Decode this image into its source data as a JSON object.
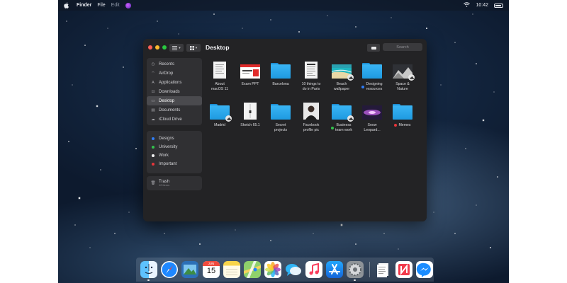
{
  "menubar": {
    "app_name": "Finder",
    "menu_file": "File",
    "menu_edit": "Edit",
    "clock": "10:42"
  },
  "window": {
    "title": "Desktop",
    "search_placeholder": "Search"
  },
  "sidebar": {
    "places": [
      {
        "label": "Recents",
        "icon": "clock-icon"
      },
      {
        "label": "AirDrop",
        "icon": "airdrop-icon"
      },
      {
        "label": "Applications",
        "icon": "applications-icon"
      },
      {
        "label": "Downloads",
        "icon": "download-icon"
      },
      {
        "label": "Desktop",
        "icon": "desktop-icon",
        "selected": true
      },
      {
        "label": "Documents",
        "icon": "document-icon"
      },
      {
        "label": "iCloud Drive",
        "icon": "cloud-icon"
      }
    ],
    "tags": [
      {
        "label": "Designs",
        "color": "#2f7df6"
      },
      {
        "label": "University",
        "color": "#33c24d"
      },
      {
        "label": "Work",
        "color": "#f2f2f2"
      },
      {
        "label": "Important",
        "color": "#e8353a"
      }
    ],
    "trash": {
      "label": "Trash",
      "subtitle": "12 items"
    }
  },
  "files": [
    {
      "label": "About\nmacOS 11",
      "kind": "doc"
    },
    {
      "label": "Exam PPT",
      "kind": "ppt"
    },
    {
      "label": "Barcelona",
      "kind": "folder"
    },
    {
      "label": "10 things to\ndo in Paris",
      "kind": "doc"
    },
    {
      "label": "Beach\nwallpaper",
      "kind": "photo-beach",
      "cloud": true
    },
    {
      "label": "Designing\nresources",
      "kind": "folder",
      "tag_color": "#2f7df6"
    },
    {
      "label": "Space &\nNature",
      "kind": "photo-space",
      "cloud": true
    },
    {
      "label": "Madrid",
      "kind": "folder",
      "cloud": true
    },
    {
      "label": "Sketch 65.1",
      "kind": "sketch"
    },
    {
      "label": "Secret\nprojects",
      "kind": "folder"
    },
    {
      "label": "Facebook\nprofile pic",
      "kind": "photo-person"
    },
    {
      "label": "Business\nteam work",
      "kind": "folder",
      "tag_color": "#33c24d",
      "cloud": true
    },
    {
      "label": "Snow\nLeopard...",
      "kind": "photo-galaxy"
    },
    {
      "label": "Memes",
      "kind": "folder",
      "tag_color": "#e8353a"
    }
  ],
  "dock": {
    "calendar_month": "JUN",
    "calendar_day": "15",
    "apps": [
      "finder-icon",
      "safari-icon",
      "preview-icon",
      "calendar-icon",
      "notes-icon",
      "maps-icon",
      "photos-icon",
      "messages-icon",
      "music-icon",
      "app-store-icon",
      "system-preferences-icon",
      "document-icon",
      "news-icon",
      "messenger-icon"
    ]
  },
  "colors": {
    "window_bg": "#232325",
    "sidebar_bg": "#303033",
    "folder_blue": "#3ab5f5"
  }
}
